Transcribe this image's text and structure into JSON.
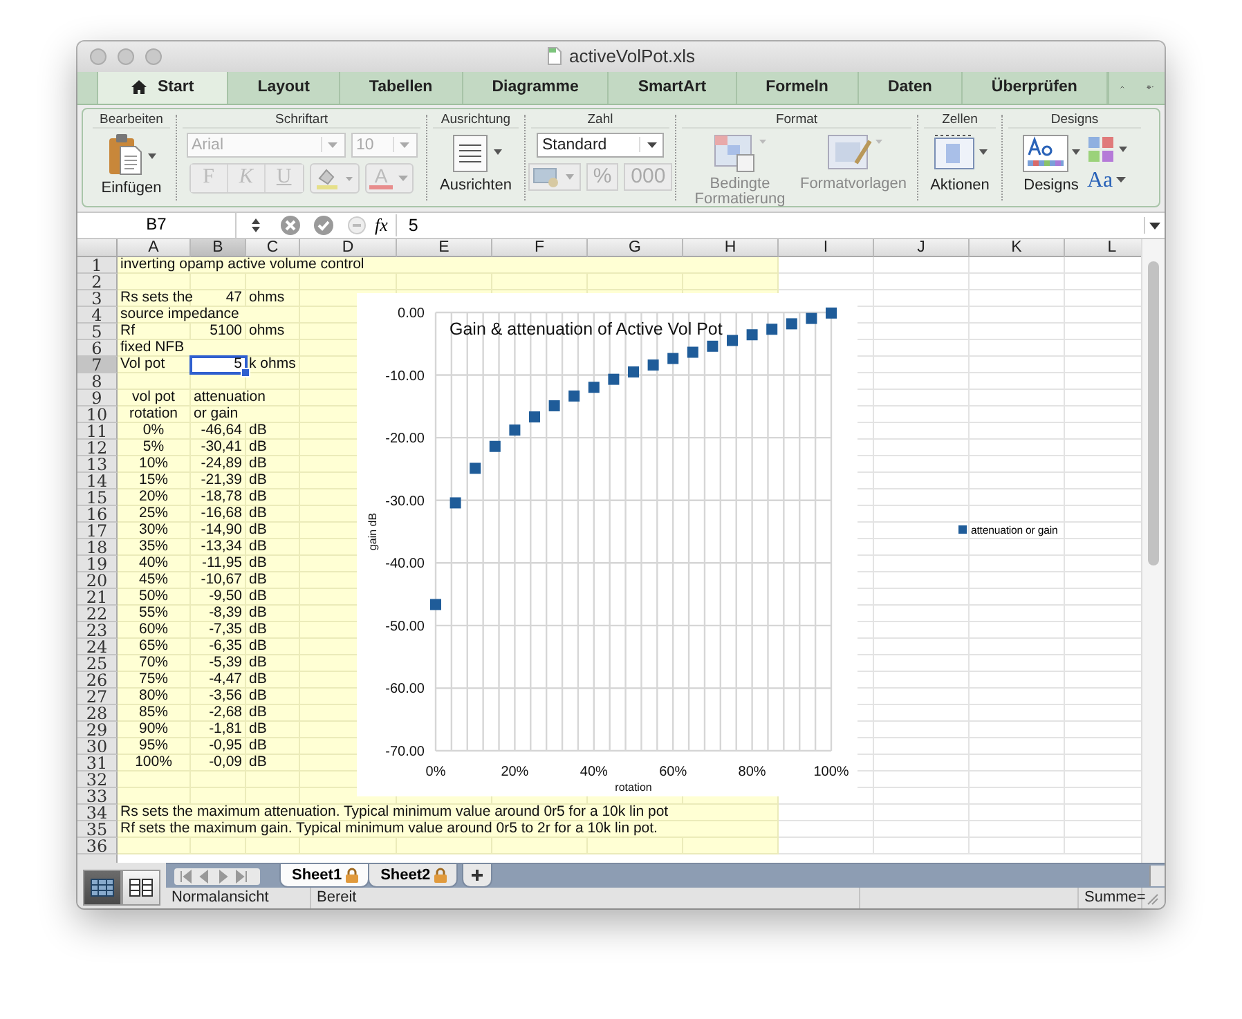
{
  "window": {
    "title": "activeVolPot.xls"
  },
  "ribbon_tabs": [
    {
      "label": "Start",
      "selected": true
    },
    {
      "label": "Layout",
      "selected": false
    },
    {
      "label": "Tabellen",
      "selected": false
    },
    {
      "label": "Diagramme",
      "selected": false
    },
    {
      "label": "SmartArt",
      "selected": false
    },
    {
      "label": "Formeln",
      "selected": false
    },
    {
      "label": "Daten",
      "selected": false
    },
    {
      "label": "Überprüfen",
      "selected": false
    }
  ],
  "ribbon": {
    "bearbeiten": {
      "title": "Bearbeiten",
      "paste": "Einfügen"
    },
    "schriftart": {
      "title": "Schriftart",
      "font": "Arial",
      "size": "10",
      "disabled": true,
      "styles": [
        "F",
        "K",
        "U"
      ],
      "font_color": "A"
    },
    "ausrichtung": {
      "title": "Ausrichtung",
      "label": "Ausrichten"
    },
    "zahl": {
      "title": "Zahl",
      "format": "Standard",
      "buttons": [
        "%",
        "000"
      ],
      "disabled": true
    },
    "format": {
      "title": "Format",
      "items": [
        {
          "label": "Bedingte Formatierung",
          "disabled": true
        },
        {
          "label": "Formatvorlagen",
          "disabled": true
        }
      ]
    },
    "zellen": {
      "title": "Zellen",
      "label": "Aktionen"
    },
    "designs": {
      "title": "Designs",
      "label": "Designs",
      "fonts": "Aa"
    }
  },
  "formula_bar": {
    "name_box": "B7",
    "function_label": "fx",
    "value": "5"
  },
  "sheet": {
    "columns": [
      {
        "label": "A",
        "selected": false
      },
      {
        "label": "B",
        "selected": true
      },
      {
        "label": "C",
        "selected": false
      },
      {
        "label": "D",
        "selected": false
      },
      {
        "label": "E",
        "selected": false
      },
      {
        "label": "F",
        "selected": false
      },
      {
        "label": "G",
        "selected": false
      },
      {
        "label": "H",
        "selected": false
      },
      {
        "label": "I",
        "selected": false
      },
      {
        "label": "J",
        "selected": false
      },
      {
        "label": "K",
        "selected": false
      },
      {
        "label": "L",
        "selected": false
      }
    ],
    "rows": [
      {
        "label": "1",
        "selected": false,
        "kind": "text",
        "A": "inverting opamp active volume control"
      },
      {
        "label": "2",
        "selected": false
      },
      {
        "label": "3",
        "selected": false,
        "kind": "param",
        "A": "Rs sets the",
        "B": "47",
        "C": "ohms"
      },
      {
        "label": "4",
        "selected": false,
        "kind": "text",
        "A": "source impedance"
      },
      {
        "label": "5",
        "selected": false,
        "kind": "param",
        "A": "Rf",
        "B": "5100",
        "C": "ohms"
      },
      {
        "label": "6",
        "selected": false,
        "kind": "text",
        "A": "fixed NFB"
      },
      {
        "label": "7",
        "selected": true,
        "kind": "param",
        "A": "Vol pot",
        "B": "5",
        "C": "k ohms"
      },
      {
        "label": "8",
        "selected": false
      },
      {
        "label": "9",
        "selected": false,
        "kind": "header",
        "A": "vol pot",
        "B": "attenuation"
      },
      {
        "label": "10",
        "selected": false,
        "kind": "header",
        "A": "rotation",
        "B": "or gain"
      },
      {
        "label": "11",
        "selected": false,
        "kind": "data",
        "A": "0%",
        "B": "-46,64",
        "C": "dB"
      },
      {
        "label": "12",
        "selected": false,
        "kind": "data",
        "A": "5%",
        "B": "-30,41",
        "C": "dB"
      },
      {
        "label": "13",
        "selected": false,
        "kind": "data",
        "A": "10%",
        "B": "-24,89",
        "C": "dB"
      },
      {
        "label": "14",
        "selected": false,
        "kind": "data",
        "A": "15%",
        "B": "-21,39",
        "C": "dB"
      },
      {
        "label": "15",
        "selected": false,
        "kind": "data",
        "A": "20%",
        "B": "-18,78",
        "C": "dB"
      },
      {
        "label": "16",
        "selected": false,
        "kind": "data",
        "A": "25%",
        "B": "-16,68",
        "C": "dB"
      },
      {
        "label": "17",
        "selected": false,
        "kind": "data",
        "A": "30%",
        "B": "-14,90",
        "C": "dB"
      },
      {
        "label": "18",
        "selected": false,
        "kind": "data",
        "A": "35%",
        "B": "-13,34",
        "C": "dB"
      },
      {
        "label": "19",
        "selected": false,
        "kind": "data",
        "A": "40%",
        "B": "-11,95",
        "C": "dB"
      },
      {
        "label": "20",
        "selected": false,
        "kind": "data",
        "A": "45%",
        "B": "-10,67",
        "C": "dB"
      },
      {
        "label": "21",
        "selected": false,
        "kind": "data",
        "A": "50%",
        "B": "-9,50",
        "C": "dB"
      },
      {
        "label": "22",
        "selected": false,
        "kind": "data",
        "A": "55%",
        "B": "-8,39",
        "C": "dB"
      },
      {
        "label": "23",
        "selected": false,
        "kind": "data",
        "A": "60%",
        "B": "-7,35",
        "C": "dB"
      },
      {
        "label": "24",
        "selected": false,
        "kind": "data",
        "A": "65%",
        "B": "-6,35",
        "C": "dB"
      },
      {
        "label": "25",
        "selected": false,
        "kind": "data",
        "A": "70%",
        "B": "-5,39",
        "C": "dB"
      },
      {
        "label": "26",
        "selected": false,
        "kind": "data",
        "A": "75%",
        "B": "-4,47",
        "C": "dB"
      },
      {
        "label": "27",
        "selected": false,
        "kind": "data",
        "A": "80%",
        "B": "-3,56",
        "C": "dB"
      },
      {
        "label": "28",
        "selected": false,
        "kind": "data",
        "A": "85%",
        "B": "-2,68",
        "C": "dB"
      },
      {
        "label": "29",
        "selected": false,
        "kind": "data",
        "A": "90%",
        "B": "-1,81",
        "C": "dB"
      },
      {
        "label": "30",
        "selected": false,
        "kind": "data",
        "A": "95%",
        "B": "-0,95",
        "C": "dB"
      },
      {
        "label": "31",
        "selected": false,
        "kind": "data",
        "A": "100%",
        "B": "-0,09",
        "C": "dB"
      },
      {
        "label": "32",
        "selected": false
      },
      {
        "label": "33",
        "selected": false
      },
      {
        "label": "34",
        "selected": false,
        "kind": "text",
        "A": "Rs sets the maximum attenuation. Typical minimum value around 0r5 for a 10k lin pot"
      },
      {
        "label": "35",
        "selected": false,
        "kind": "text",
        "A": "Rf sets the maximum gain. Typical minimum value around 0r5 to 2r for a 10k lin pot."
      },
      {
        "label": "36",
        "selected": false
      }
    ]
  },
  "chart": {
    "chart_data": {
      "type": "scatter",
      "title": "Gain & attenuation of Active Vol Pot",
      "xlabel": "rotation",
      "ylabel": "gain dB",
      "x": [
        0,
        5,
        10,
        15,
        20,
        25,
        30,
        35,
        40,
        45,
        50,
        55,
        60,
        65,
        70,
        75,
        80,
        85,
        90,
        95,
        100
      ],
      "series": [
        {
          "name": "attenuation or gain",
          "color": "#1f5c99",
          "values": [
            -46.64,
            -30.41,
            -24.89,
            -21.39,
            -18.78,
            -16.68,
            -14.9,
            -13.34,
            -11.95,
            -10.67,
            -9.5,
            -8.39,
            -7.35,
            -6.35,
            -5.39,
            -4.47,
            -3.56,
            -2.68,
            -1.81,
            -0.95,
            -0.09
          ]
        }
      ],
      "xlim": [
        0,
        100
      ],
      "ylim": [
        -70,
        0
      ],
      "grid": true,
      "xticks": [
        {
          "value": 0,
          "label": "0%"
        },
        {
          "value": 20,
          "label": "20%"
        },
        {
          "value": 40,
          "label": "40%"
        },
        {
          "value": 60,
          "label": "60%"
        },
        {
          "value": 80,
          "label": "80%"
        },
        {
          "value": 100,
          "label": "100%"
        }
      ],
      "yticks": [
        {
          "value": 0,
          "label": "0.00"
        },
        {
          "value": -10,
          "label": "-10.00"
        },
        {
          "value": -20,
          "label": "-20.00"
        },
        {
          "value": -30,
          "label": "-30.00"
        },
        {
          "value": -40,
          "label": "-40.00"
        },
        {
          "value": -50,
          "label": "-50.00"
        },
        {
          "value": -60,
          "label": "-60.00"
        },
        {
          "value": -70,
          "label": "-70.00"
        }
      ]
    }
  },
  "sheet_tabs": [
    {
      "label": "Sheet1",
      "selected": true
    },
    {
      "label": "Sheet2",
      "selected": false
    }
  ],
  "status_bar": {
    "view": "Normalansicht",
    "state": "Bereit",
    "sum": "Summe="
  }
}
